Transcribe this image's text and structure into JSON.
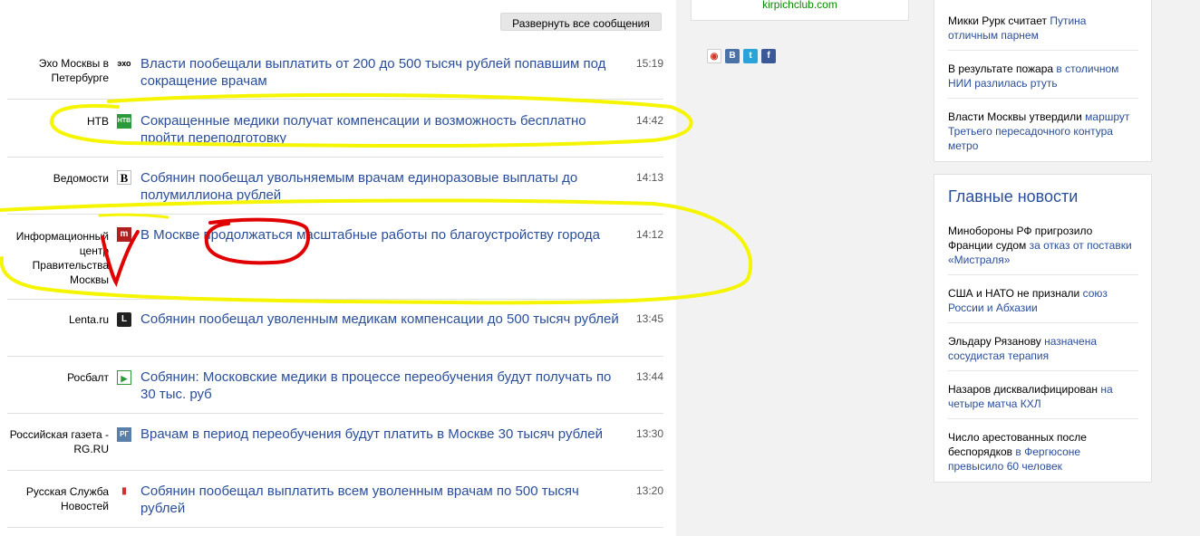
{
  "toolbar": {
    "expand_all_label": "Развернуть все сообщения"
  },
  "news_rows": [
    {
      "source": "Эхо Москвы в Петербурге",
      "icon_label": "эхо",
      "icon": "echo-icon",
      "title": "Власти пообещали выплатить от 200 до 500 тысяч рублей попавшим под сокращение врачам",
      "time": "15:19"
    },
    {
      "source": "НТВ",
      "icon_label": "НТВ",
      "icon": "ntv-icon",
      "title": "Сокращенные медики получат компенсации и возможность бесплатно пройти переподготовку",
      "time": "14:42"
    },
    {
      "source": "Ведомости",
      "icon_label": "В",
      "icon": "vedomosti-icon",
      "title": "Собянин пообещал увольняемым врачам единоразовые выплаты до полумиллиона рублей",
      "time": "14:13"
    },
    {
      "source": "Информационный центр Правительства Москвы",
      "icon_label": "m",
      "icon": "mos-icon",
      "title": "В Москве продолжаться масштабные работы по благоустройству города",
      "time": "14:12"
    },
    {
      "source": "Lenta.ru",
      "icon_label": "L",
      "icon": "lenta-icon",
      "title": "Собянин пообещал уволенным медикам компенсации до 500 тысяч рублей",
      "time": "13:45"
    },
    {
      "source": "Росбалт",
      "icon_label": "▶",
      "icon": "rosbalt-icon",
      "title": "Собянин: Московские медики в процессе переобучения будут получать по 30 тыс. руб",
      "time": "13:44"
    },
    {
      "source": "Российская газета - RG.RU",
      "icon_label": "РГ",
      "icon": "rg-icon",
      "title": "Врачам в период переобучения будут платить в Москве 30 тысяч рублей",
      "time": "13:30"
    },
    {
      "source": "Русская Служба Новостей",
      "icon_label": "▮",
      "icon": "rsn-icon",
      "title": "Собянин пообещал выплатить всем уволенным врачам по 500 тысяч рублей",
      "time": "13:20"
    }
  ],
  "ad": {
    "link": "kirpichclub.com"
  },
  "share": [
    {
      "label": "◉",
      "icon": "mail-share-icon",
      "color": "#d03a2a"
    },
    {
      "label": "В",
      "icon": "vk-share-icon",
      "color": "#4a72a6"
    },
    {
      "label": "t",
      "icon": "twitter-share-icon",
      "color": "#2aa3d8"
    },
    {
      "label": "f",
      "icon": "facebook-share-icon",
      "color": "#3b5998"
    }
  ],
  "top_panel": [
    {
      "plain": "Микки Рурк считает ",
      "link": "Путина отличным парнем"
    },
    {
      "plain": "В результате пожара ",
      "link": "в столичном НИИ разлилась ртуть"
    },
    {
      "plain": "Власти Москвы утвердили ",
      "link": "маршрут Третьего пересадочного контура метро"
    }
  ],
  "main_news": {
    "title": "Главные новости",
    "items": [
      {
        "plain": "Минобороны РФ пригрозило Франции судом ",
        "link": "за отказ от поставки «Мистраля»"
      },
      {
        "plain": "США и НАТО не признали ",
        "link": "союз России и Абхазии"
      },
      {
        "plain": "Эльдару Рязанову ",
        "link": "назначена сосудистая терапия"
      },
      {
        "plain": "Назаров дисквалифицирован ",
        "link": "на четыре матча КХЛ"
      },
      {
        "plain": "Число арестованных после беспорядков ",
        "link": "в Фергюсоне превысило 60 человек"
      }
    ]
  },
  "colors": {
    "link": "#2a4e9a",
    "highlight_yellow": "#f5f500",
    "highlight_red": "#e00000"
  }
}
